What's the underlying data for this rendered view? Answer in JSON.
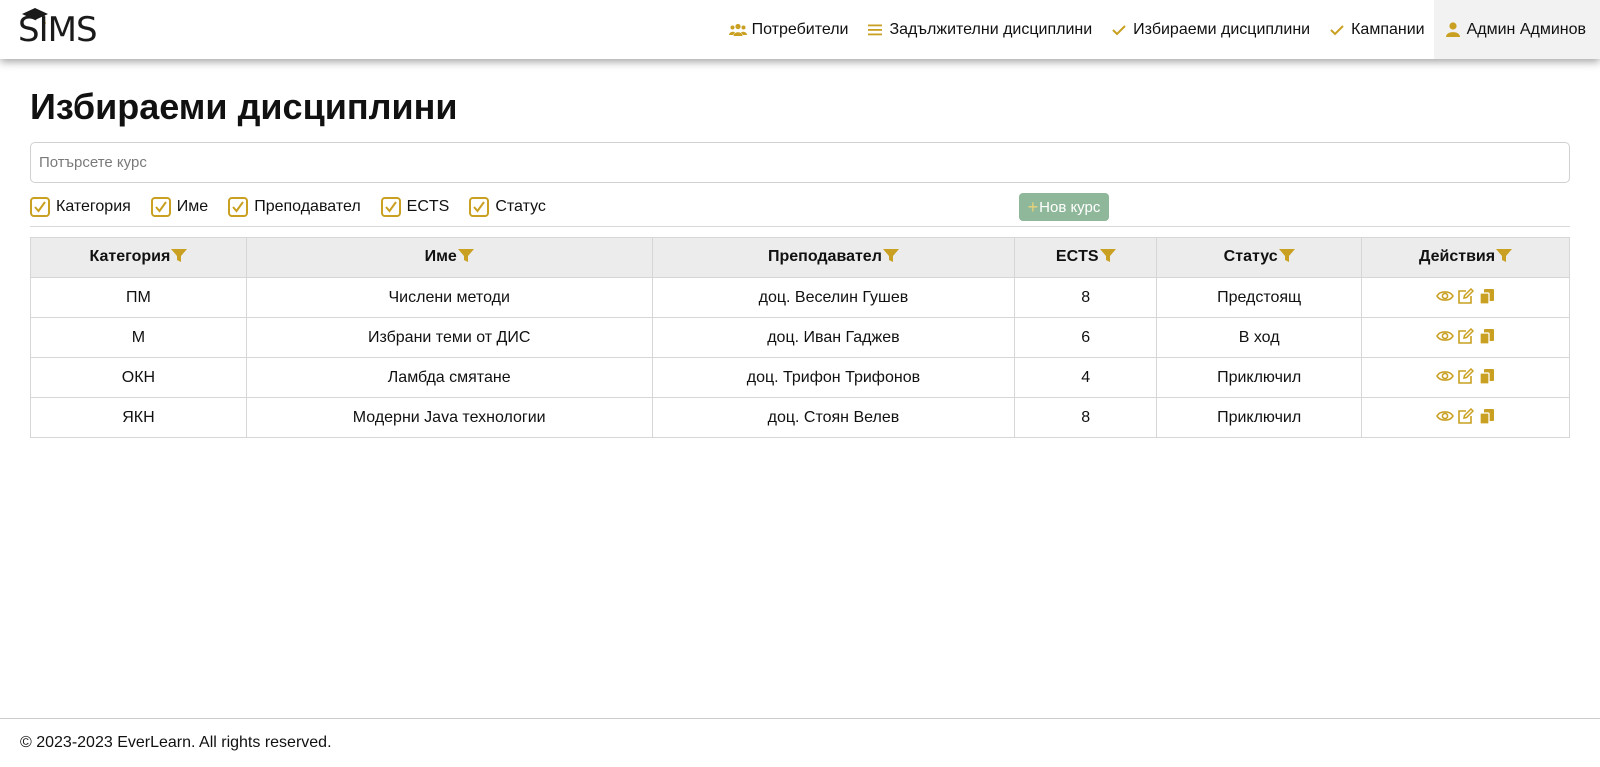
{
  "brand": {
    "logo_text": "SIMS"
  },
  "nav": {
    "items": [
      {
        "label": "Потребители",
        "icon": "users-icon"
      },
      {
        "label": "Задължителни дисциплини",
        "icon": "list-icon"
      },
      {
        "label": "Избираеми дисциплини",
        "icon": "check-icon"
      },
      {
        "label": "Кампании",
        "icon": "check-icon"
      },
      {
        "label": "Админ Админов",
        "icon": "user-icon"
      }
    ]
  },
  "page": {
    "title": "Избираеми дисциплини",
    "search_placeholder": "Потърсете курс"
  },
  "filters": [
    {
      "label": "Категория",
      "checked": true
    },
    {
      "label": "Име",
      "checked": true
    },
    {
      "label": "Преподавател",
      "checked": true
    },
    {
      "label": "ECTS",
      "checked": true
    },
    {
      "label": "Статус",
      "checked": true
    }
  ],
  "new_course_label": "Нов курс",
  "table": {
    "headers": [
      "Категория",
      "Име",
      "Преподавател",
      "ECTS",
      "Статус",
      "Действия"
    ],
    "rows": [
      [
        "ПМ",
        "Числени методи",
        "доц. Веселин Гушев",
        "8",
        "Предстоящ"
      ],
      [
        "М",
        "Избрани теми от ДИС",
        "доц. Иван Гаджев",
        "6",
        "В ход"
      ],
      [
        "ОКН",
        "Ламбда смятане",
        "доц. Трифон Трифонов",
        "4",
        "Приключил"
      ],
      [
        "ЯКН",
        "Модерни Java технологии",
        "доц. Стоян Велев",
        "8",
        "Приключил"
      ]
    ]
  },
  "footer": {
    "text": "© 2023-2023 EverLearn. All rights reserved."
  },
  "colors": {
    "accent": "#c9a021",
    "button": "#8fb89a",
    "header_bg": "#ececec"
  }
}
